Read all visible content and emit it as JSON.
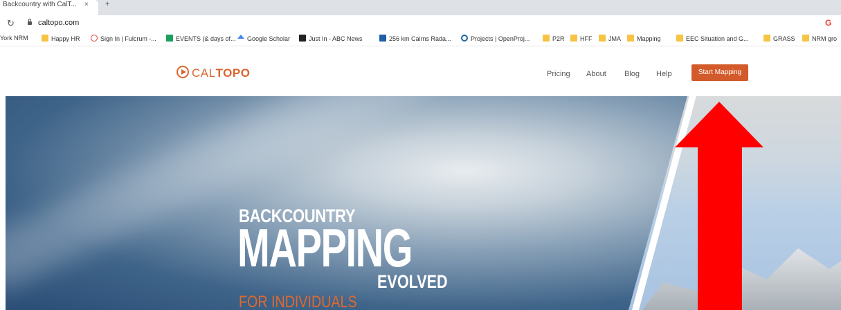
{
  "browser": {
    "tab_title": "Backcountry with CalT...",
    "tab_close": "×",
    "new_tab": "+",
    "url": "caltopo.com",
    "account_glyph": "G"
  },
  "bookmarks": [
    {
      "label": "York NRM",
      "icon": "none"
    },
    {
      "label": "Happy HR",
      "icon": "folder"
    },
    {
      "label": "Sign In | Fulcrum -...",
      "icon": "fulcrum-icon"
    },
    {
      "label": "EVENTS (& days of...",
      "icon": "calendar-icon"
    },
    {
      "label": "Google Scholar",
      "icon": "scholar-icon"
    },
    {
      "label": "Just In - ABC News",
      "icon": "abc-icon"
    },
    {
      "label": "256 km Cairns Rada...",
      "icon": "bom-icon"
    },
    {
      "label": "Projects | OpenProj...",
      "icon": "openproject-icon"
    },
    {
      "label": "P2R",
      "icon": "folder"
    },
    {
      "label": "HFF",
      "icon": "folder"
    },
    {
      "label": "JMA",
      "icon": "folder"
    },
    {
      "label": "Mapping",
      "icon": "folder"
    },
    {
      "label": "EEC Situation and G...",
      "icon": "folder"
    },
    {
      "label": "GRASS",
      "icon": "folder"
    },
    {
      "label": "NRM gro",
      "icon": "folder"
    }
  ],
  "site": {
    "logo_light": "CAL",
    "logo_bold": "TOPO",
    "nav": {
      "pricing": "Pricing",
      "about": "About",
      "blog": "Blog",
      "help": "Help",
      "start_mapping": "Start Mapping"
    },
    "hero": {
      "line1": "BACKCOUNTRY",
      "line2": "MAPPING",
      "line3": "EVOLVED",
      "line4": "FOR INDIVIDUALS"
    },
    "colors": {
      "brand": "#d9662f",
      "button": "#d35a2a",
      "annotation_arrow": "#ff0000"
    }
  }
}
